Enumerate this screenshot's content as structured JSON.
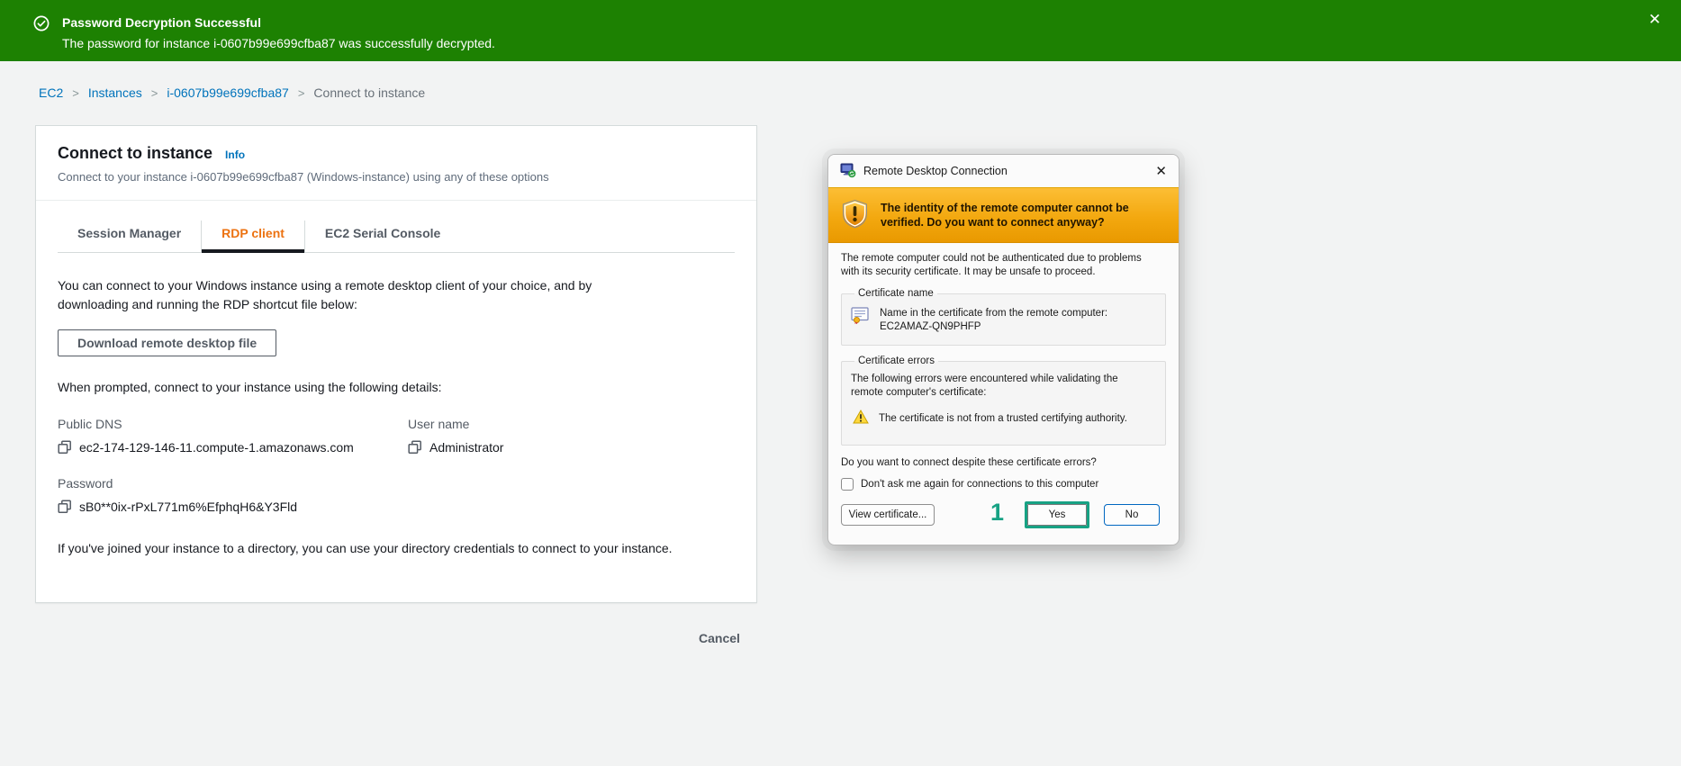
{
  "banner": {
    "title": "Password Decryption Successful",
    "message": "The password for instance i-0607b99e699cfba87 was successfully decrypted.",
    "close_glyph": "✕",
    "bg_color": "#1d8102"
  },
  "breadcrumb": {
    "separator": ">",
    "items": [
      {
        "label": "EC2"
      },
      {
        "label": "Instances"
      },
      {
        "label": "i-0607b99e699cfba87"
      },
      {
        "label": "Connect to instance"
      }
    ]
  },
  "panel": {
    "title": "Connect to instance",
    "info_label": "Info",
    "description": "Connect to your instance i-0607b99e699cfba87 (Windows-instance) using any of these options",
    "tabs": [
      {
        "label": "Session Manager",
        "active": false
      },
      {
        "label": "RDP client",
        "active": true
      },
      {
        "label": "EC2 Serial Console",
        "active": false
      }
    ],
    "intro_text": "You can connect to your Windows instance using a remote desktop client of your choice, and by downloading and running the RDP shortcut file below:",
    "download_button_label": "Download remote desktop file",
    "prompt_text": "When prompted, connect to your instance using the following details:",
    "fields": {
      "public_dns": {
        "label": "Public DNS",
        "value": "ec2-174-129-146-11.compute-1.amazonaws.com"
      },
      "user_name": {
        "label": "User name",
        "value": "Administrator"
      },
      "password": {
        "label": "Password",
        "value": "sB0**0ix-rPxL771m6%EfphqH6&Y3Fld"
      }
    },
    "directory_note": "If you've joined your instance to a directory, you can use your directory credentials to connect to your instance.",
    "cancel_label": "Cancel"
  },
  "dialog": {
    "title": "Remote Desktop Connection",
    "close_glyph": "✕",
    "warning_header": "The identity of the remote computer cannot be verified. Do you want to connect anyway?",
    "body_text": "The remote computer could not be authenticated due to problems with its security certificate. It may be unsafe to proceed.",
    "certificate_name_group": {
      "legend": "Certificate name",
      "text": "Name in the certificate from the remote computer:",
      "value": "EC2AMAZ-QN9PHFP"
    },
    "certificate_errors_group": {
      "legend": "Certificate errors",
      "text": "The following errors were encountered while validating the remote computer's certificate:",
      "error": "The certificate is not from a trusted certifying authority."
    },
    "question": "Do you want to connect despite these certificate errors?",
    "checkbox": {
      "label": "Don't ask me again for connections to this computer",
      "checked": false
    },
    "buttons": {
      "view_certificate": "View certificate...",
      "yes": "Yes",
      "no": "No"
    },
    "annotation": {
      "number": "1",
      "color": "#17a284"
    }
  },
  "colors": {
    "success_green": "#1d8102",
    "link_blue": "#0073bb",
    "active_tab_orange": "#ec7211",
    "tab_underline": "#16191f",
    "warning_band_top": "#fcbe35",
    "warning_band_bottom": "#e99900",
    "windows_accent_blue": "#0067c0",
    "annotation_teal": "#17a284",
    "page_background": "#f2f3f3"
  },
  "icons": {
    "banner_status": "check-circle-icon",
    "copy": "copy-icon",
    "dialog_app": "remote-desktop-icon",
    "warning_shield": "shield-warning-icon",
    "certificate": "certificate-icon",
    "warning_triangle": "warning-triangle-icon"
  }
}
